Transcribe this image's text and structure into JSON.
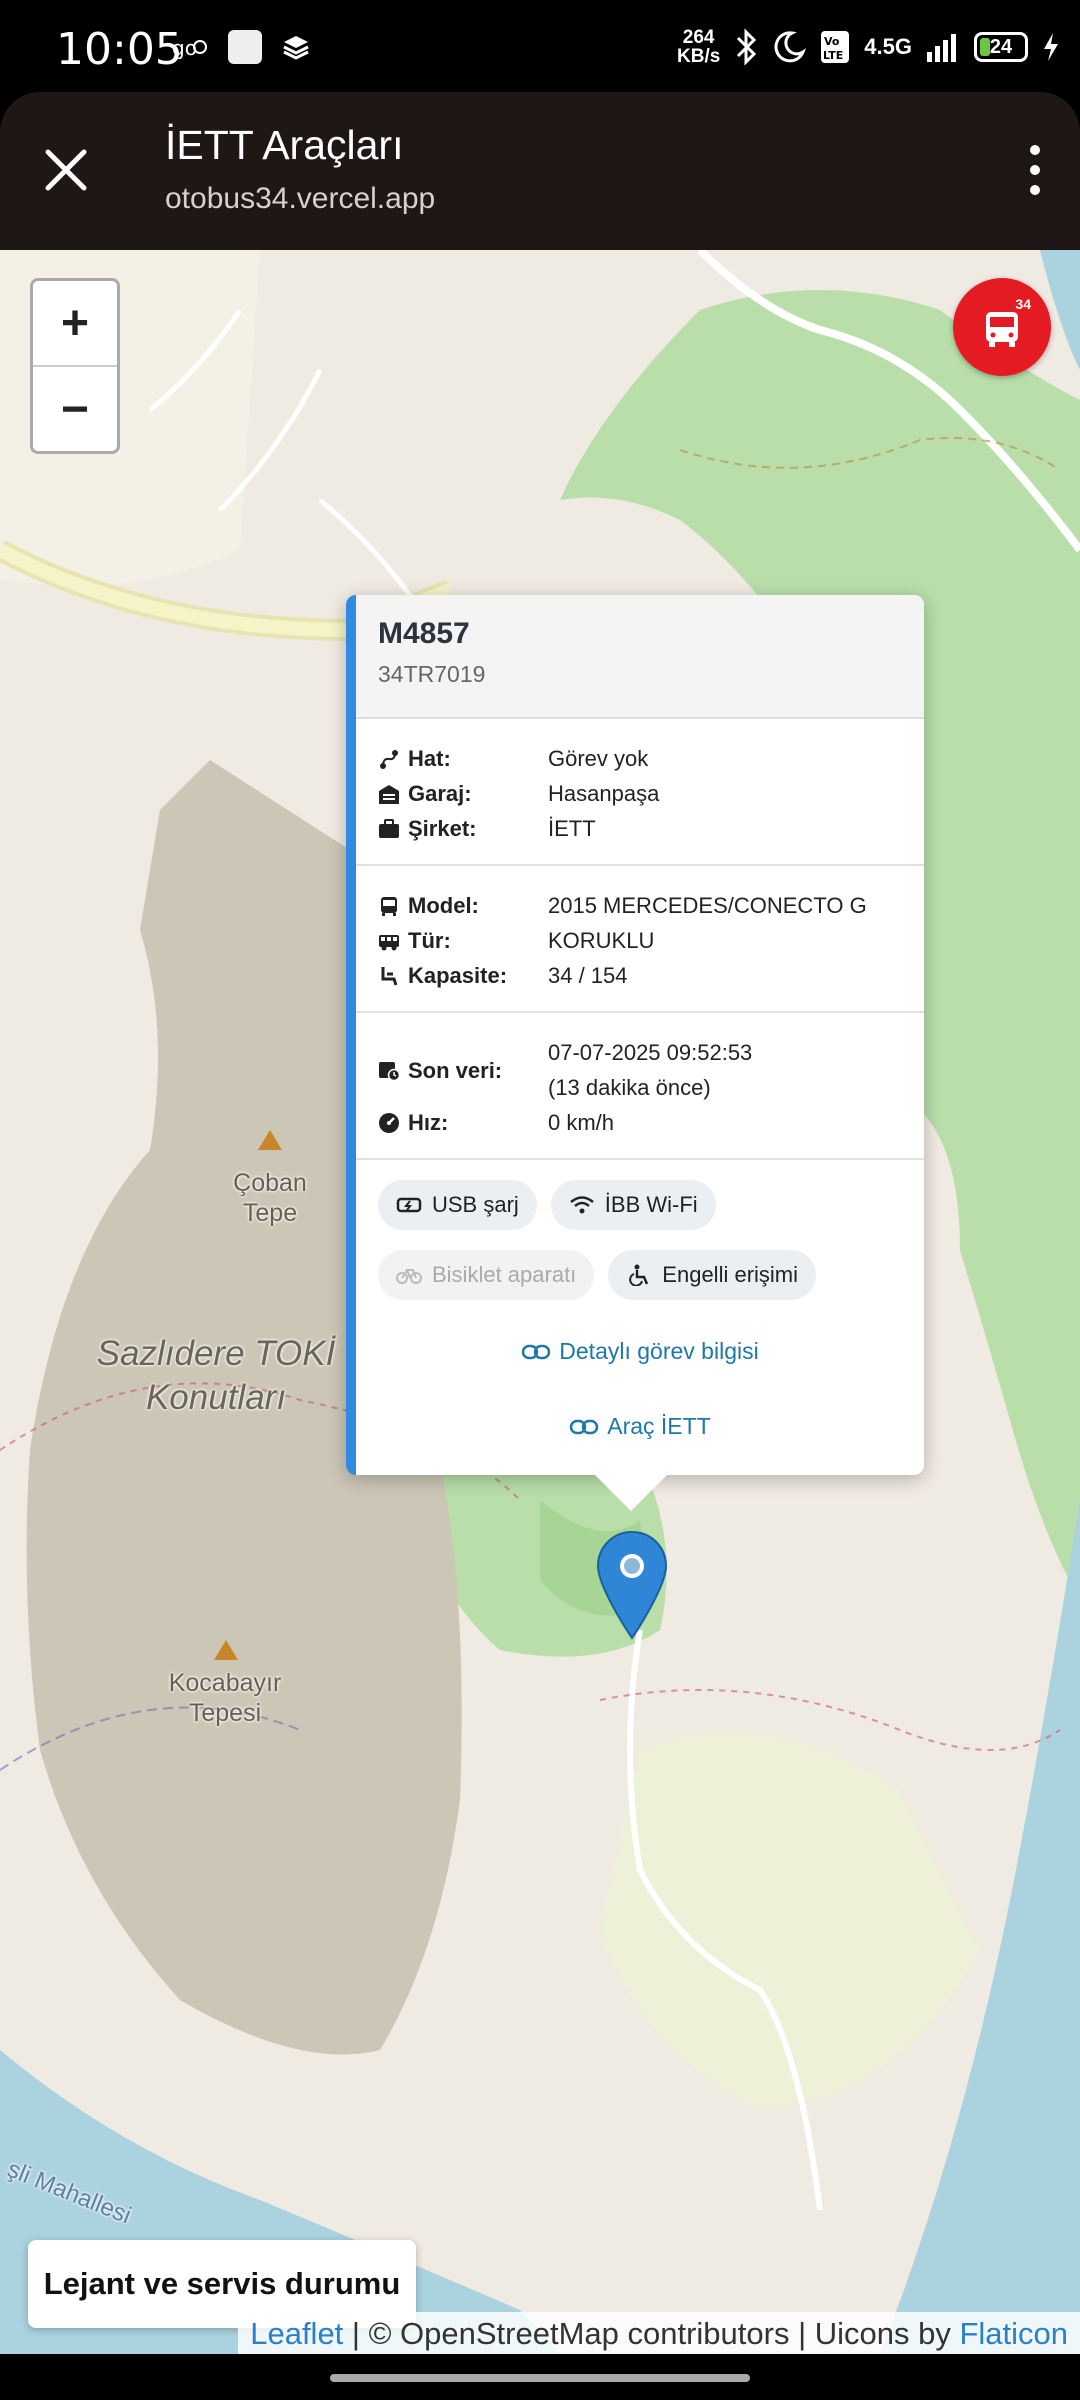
{
  "status_bar": {
    "time": "10:05",
    "speed": "264 KB/s",
    "network": "4.5G",
    "battery": "24",
    "battery_level": 24
  },
  "browser_header": {
    "title": "İETT Araçları",
    "url": "otobus34.vercel.app"
  },
  "map": {
    "zoom_in": "+",
    "zoom_out": "−",
    "fab_badge": "34",
    "place_labels": {
      "coban": "Çoban Tepe",
      "sazlidere": "Sazlıdere TOKİ Konutları",
      "kocabayir": "Kocabayır Tepesi",
      "mahalle": "şli Mahallesi"
    }
  },
  "popup": {
    "vehicle_id": "M4857",
    "plate": "34TR7019",
    "section1": [
      {
        "icon": "route-icon",
        "key": "Hat:",
        "value": "Görev yok"
      },
      {
        "icon": "garage-icon",
        "key": "Garaj:",
        "value": "Hasanpaşa"
      },
      {
        "icon": "briefcase-icon",
        "key": "Şirket:",
        "value": "İETT"
      }
    ],
    "section2": [
      {
        "icon": "bus-icon",
        "key": "Model:",
        "value": "2015 MERCEDES/CONECTO G"
      },
      {
        "icon": "bus-side-icon",
        "key": "Tür:",
        "value": "KORUKLU"
      },
      {
        "icon": "seat-icon",
        "key": "Kapasite:",
        "value": "34 / 154"
      }
    ],
    "section3": {
      "last_data_key": "Son veri:",
      "last_data_value": "07-07-2025 09:52:53",
      "last_data_ago": "(13 dakika önce)",
      "speed_key": "Hız:",
      "speed_value": "0 km/h"
    },
    "features": [
      {
        "icon": "usb-charge-icon",
        "label": "USB şarj",
        "enabled": true
      },
      {
        "icon": "wifi-icon",
        "label": "İBB Wi-Fi",
        "enabled": true
      },
      {
        "icon": "bicycle-icon",
        "label": "Bisiklet aparatı",
        "enabled": false
      },
      {
        "icon": "wheelchair-icon",
        "label": "Engelli erişimi",
        "enabled": true
      }
    ],
    "link_detail": "Detaylı görev bilgisi",
    "link_vehicle": "Araç İETT"
  },
  "legend_button": "Lejant ve servis durumu",
  "attribution": {
    "leaflet": "Leaflet",
    "osm": " | © OpenStreetMap contributors | Uicons by ",
    "flaticon": "Flaticon"
  },
  "colors": {
    "accent": "#2f8ae0",
    "fab": "#e51b23",
    "link": "#1e78a8",
    "forest": "#a8d69a",
    "water": "#aad3df"
  }
}
